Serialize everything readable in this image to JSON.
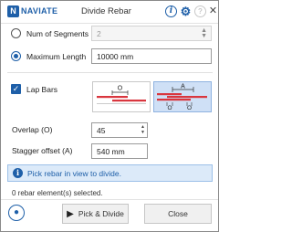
{
  "titlebar": {
    "logo_letter": "N",
    "logo_text": "NAVIATE",
    "title": "Divide Rebar",
    "info_glyph": "i",
    "help_glyph": "?",
    "icons": [
      "info-icon",
      "gear-icon",
      "help-icon",
      "close-icon"
    ]
  },
  "mode": {
    "num_segments": {
      "label": "Num of Segments",
      "value": "2",
      "selected": false,
      "enabled": false
    },
    "max_length": {
      "label": "Maximum Length",
      "value": "10000 mm",
      "selected": true
    }
  },
  "lap": {
    "checkbox_label": "Lap Bars",
    "checked": true,
    "options": [
      {
        "name": "overlap-lap",
        "dimension_label": "O",
        "selected": false
      },
      {
        "name": "stagger-lap",
        "dimension_labels": [
          "A",
          "O",
          "O"
        ],
        "selected": true
      }
    ],
    "overlap": {
      "label": "Overlap (O)",
      "value": "45"
    },
    "stagger_offset": {
      "label": "Stagger offset (A)",
      "value": "540 mm"
    }
  },
  "info_message": "Pick rebar in view to divide.",
  "status_text": "0 rebar element(s) selected.",
  "buttons": {
    "pick_divide": "Pick & Divide",
    "close": "Close"
  },
  "colors": {
    "accent": "#1e5fa8",
    "rebar_red": "#d9363e",
    "selected_bg": "#cfe0f6"
  }
}
